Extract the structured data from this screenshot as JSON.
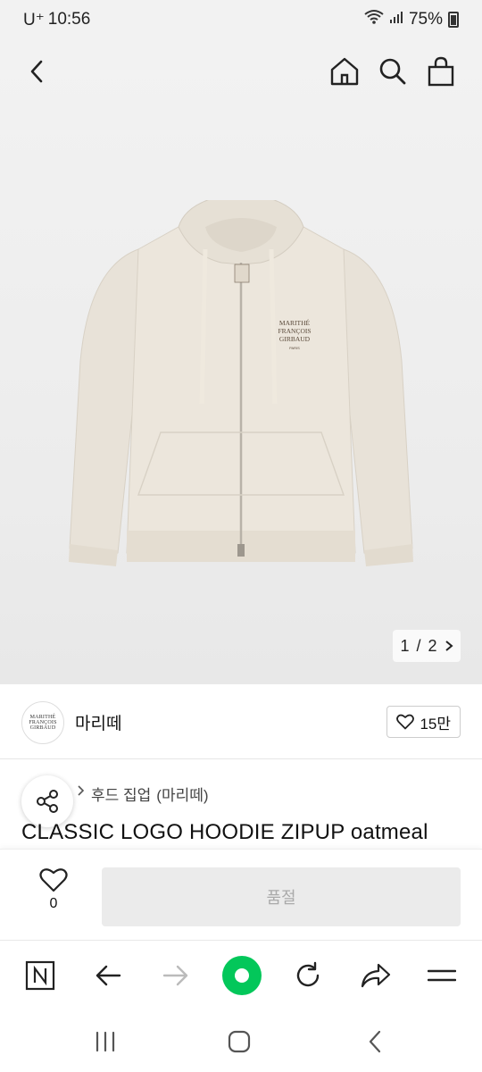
{
  "status_bar": {
    "carrier": "U⁺",
    "time": "10:56",
    "battery": "75%"
  },
  "hero": {
    "pager": {
      "current": "1",
      "separator": "/",
      "total": "2"
    }
  },
  "seller": {
    "name": "마리떼",
    "like_count": "15만",
    "logo_lines": [
      "MARITHÉ",
      "FRANÇOIS",
      "GIRBAUD"
    ]
  },
  "product": {
    "breadcrumb": [
      "후드 집업",
      "(마리떼)"
    ],
    "title": "CLASSIC LOGO HOODIE ZIPUP oatmeal",
    "chest_logo_lines": [
      "MARITHÉ",
      "FRANÇOIS",
      "GIRBAUD",
      "PARIS"
    ]
  },
  "bottom_action": {
    "wish_count": "0",
    "buy_label": "품절"
  },
  "colors": {
    "accent_green": "#03c75a",
    "garment": "#e8e2d8"
  },
  "icons": {
    "top_nav": [
      "back-icon",
      "home-icon",
      "search-icon",
      "shopping-bag-icon"
    ],
    "browser_bar": [
      "naver-n-icon",
      "arrow-left-icon",
      "arrow-right-icon",
      "green-circle-icon",
      "reload-icon",
      "share-arrow-icon",
      "menu-icon"
    ],
    "android_nav": [
      "recent-apps-icon",
      "home-circle-icon",
      "back-chevron-icon"
    ]
  }
}
